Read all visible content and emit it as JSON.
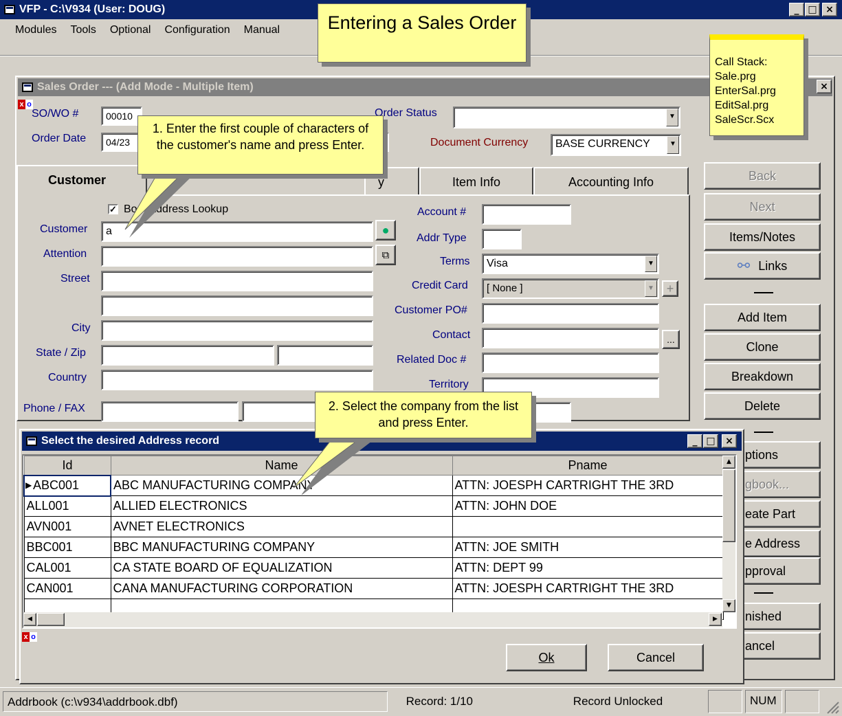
{
  "app": {
    "title": "VFP - C:\\V934  (User: DOUG)",
    "menu": [
      "Modules",
      "Tools",
      "Optional",
      "Configuration",
      "Manual"
    ]
  },
  "callouts": {
    "main_title": "Entering a Sales Order",
    "call_stack": [
      "Call Stack:",
      "Sale.prg",
      "EnterSal.prg",
      "EditSal.prg",
      "SaleScr.Scx"
    ],
    "step1": "1.  Enter the first couple of characters of the customer's name and press Enter.",
    "step2": "2.  Select the company from the list and press Enter."
  },
  "sales_order": {
    "title": "Sales Order --- (Add Mode - Multiple Item)",
    "so_label": "SO/WO #",
    "so_value": "00010",
    "order_date_label": "Order Date",
    "order_date_value": "04/23",
    "order_status_label": "Order Status",
    "order_status_value": "",
    "doc_currency_label": "Document Currency",
    "doc_currency_value": "BASE CURRENCY",
    "tabs": [
      "Customer",
      "y",
      "Item Info",
      "Accounting Info"
    ],
    "lookup_checkbox_label": "Bo... Address Lookup",
    "left_fields": {
      "customer_label": "Customer",
      "customer_value": "a",
      "attention_label": "Attention",
      "street_label": "Street",
      "city_label": "City",
      "state_zip_label": "State / Zip",
      "country_label": "Country",
      "phone_fax_label": "Phone / FAX"
    },
    "right_fields": {
      "account_label": "Account #",
      "addr_type_label": "Addr Type",
      "terms_label": "Terms",
      "terms_value": "Visa",
      "credit_card_label": "Credit Card",
      "credit_card_value": "[ None ]",
      "customer_po_label": "Customer PO#",
      "contact_label": "Contact",
      "related_doc_label": "Related Doc #",
      "territory_label": "Territory"
    },
    "side_buttons": [
      "Back",
      "Next",
      "Items/Notes",
      "Links",
      "Add Item",
      "Clone",
      "Breakdown",
      "Delete",
      "ptions",
      "gbook...",
      "eate Part",
      "e Address",
      "pproval",
      "nished",
      "ancel"
    ]
  },
  "address_dialog": {
    "title": "Select the desired Address record",
    "columns": [
      "Id",
      "Name",
      "Pname"
    ],
    "rows": [
      [
        "ABC001",
        "ABC MANUFACTURING COMPANY",
        "ATTN: JOESPH CARTRIGHT THE 3RD"
      ],
      [
        "ALL001",
        "ALLIED ELECTRONICS",
        "ATTN: JOHN DOE"
      ],
      [
        "AVN001",
        "AVNET ELECTRONICS",
        ""
      ],
      [
        "BBC001",
        "BBC MANUFACTURING COMPANY",
        "ATTN: JOE SMITH"
      ],
      [
        "CAL001",
        "CA STATE BOARD OF EQUALIZATION",
        "ATTN: DEPT 99"
      ],
      [
        "CAN001",
        "CANA MANUFACTURING CORPORATION",
        "ATTN: JOESPH CARTRIGHT THE 3RD"
      ]
    ],
    "ok_label": "Ok",
    "cancel_label": "Cancel"
  },
  "statusbar": {
    "file": "Addrbook (c:\\v934\\addrbook.dbf)",
    "record": "Record: 1/10",
    "lock": "Record Unlocked",
    "num": "NUM"
  }
}
